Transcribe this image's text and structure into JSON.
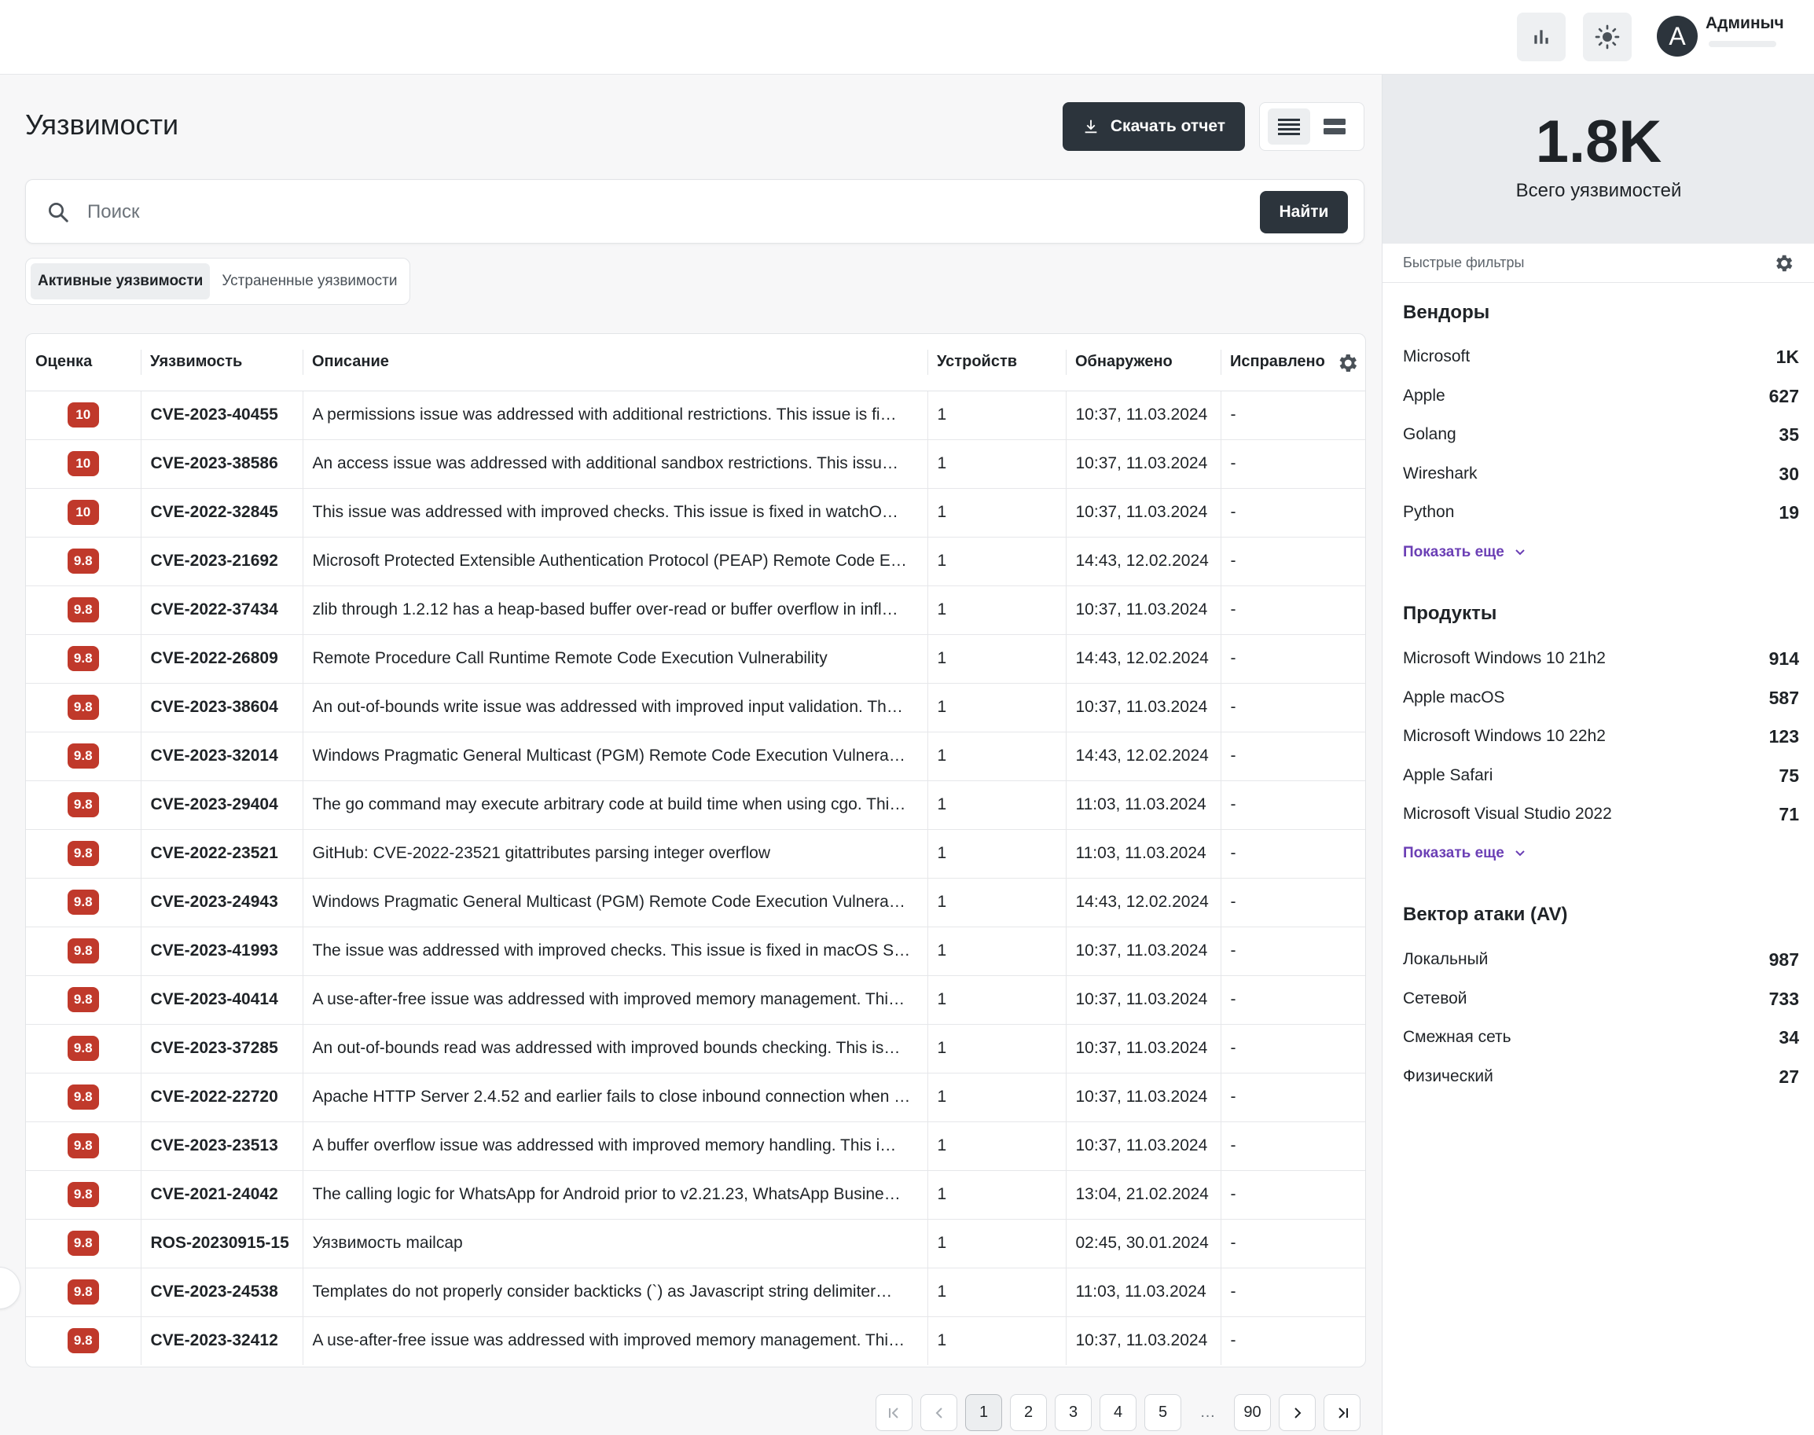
{
  "topbar": {
    "user_name": "Админыч",
    "user_initial": "A"
  },
  "page": {
    "title": "Уязвимости",
    "download_label": "Скачать отчет"
  },
  "search": {
    "placeholder": "Поиск",
    "button_label": "Найти"
  },
  "tabs": [
    {
      "label": "Активные уязвимости",
      "active": true
    },
    {
      "label": "Устраненные уязвимости",
      "active": false
    }
  ],
  "table": {
    "columns": [
      "Оценка",
      "Уязвимость",
      "Описание",
      "Устройств",
      "Обнаружено",
      "Исправлено"
    ],
    "rows": [
      {
        "score": "10",
        "id": "CVE-2023-40455",
        "desc": "A permissions issue was addressed with additional restrictions. This issue is fi…",
        "devices": "1",
        "found": "10:37, 11.03.2024",
        "fixed": "-"
      },
      {
        "score": "10",
        "id": "CVE-2023-38586",
        "desc": "An access issue was addressed with additional sandbox restrictions. This issu…",
        "devices": "1",
        "found": "10:37, 11.03.2024",
        "fixed": "-"
      },
      {
        "score": "10",
        "id": "CVE-2022-32845",
        "desc": "This issue was addressed with improved checks. This issue is fixed in watchO…",
        "devices": "1",
        "found": "10:37, 11.03.2024",
        "fixed": "-"
      },
      {
        "score": "9.8",
        "id": "CVE-2023-21692",
        "desc": "Microsoft Protected Extensible Authentication Protocol (PEAP) Remote Code E…",
        "devices": "1",
        "found": "14:43, 12.02.2024",
        "fixed": "-"
      },
      {
        "score": "9.8",
        "id": "CVE-2022-37434",
        "desc": "zlib through 1.2.12 has a heap-based buffer over-read or buffer overflow in infl…",
        "devices": "1",
        "found": "10:37, 11.03.2024",
        "fixed": "-"
      },
      {
        "score": "9.8",
        "id": "CVE-2022-26809",
        "desc": "Remote Procedure Call Runtime Remote Code Execution Vulnerability",
        "devices": "1",
        "found": "14:43, 12.02.2024",
        "fixed": "-"
      },
      {
        "score": "9.8",
        "id": "CVE-2023-38604",
        "desc": "An out-of-bounds write issue was addressed with improved input validation. Th…",
        "devices": "1",
        "found": "10:37, 11.03.2024",
        "fixed": "-"
      },
      {
        "score": "9.8",
        "id": "CVE-2023-32014",
        "desc": "Windows Pragmatic General Multicast (PGM) Remote Code Execution Vulnera…",
        "devices": "1",
        "found": "14:43, 12.02.2024",
        "fixed": "-"
      },
      {
        "score": "9.8",
        "id": "CVE-2023-29404",
        "desc": "The go command may execute arbitrary code at build time when using cgo. Thi…",
        "devices": "1",
        "found": "11:03, 11.03.2024",
        "fixed": "-"
      },
      {
        "score": "9.8",
        "id": "CVE-2022-23521",
        "desc": "GitHub: CVE-2022-23521 gitattributes parsing integer overflow",
        "devices": "1",
        "found": "11:03, 11.03.2024",
        "fixed": "-"
      },
      {
        "score": "9.8",
        "id": "CVE-2023-24943",
        "desc": "Windows Pragmatic General Multicast (PGM) Remote Code Execution Vulnera…",
        "devices": "1",
        "found": "14:43, 12.02.2024",
        "fixed": "-"
      },
      {
        "score": "9.8",
        "id": "CVE-2023-41993",
        "desc": "The issue was addressed with improved checks. This issue is fixed in macOS S…",
        "devices": "1",
        "found": "10:37, 11.03.2024",
        "fixed": "-"
      },
      {
        "score": "9.8",
        "id": "CVE-2023-40414",
        "desc": "A use-after-free issue was addressed with improved memory management. Thi…",
        "devices": "1",
        "found": "10:37, 11.03.2024",
        "fixed": "-"
      },
      {
        "score": "9.8",
        "id": "CVE-2023-37285",
        "desc": "An out-of-bounds read was addressed with improved bounds checking. This is…",
        "devices": "1",
        "found": "10:37, 11.03.2024",
        "fixed": "-"
      },
      {
        "score": "9.8",
        "id": "CVE-2022-22720",
        "desc": "Apache HTTP Server 2.4.52 and earlier fails to close inbound connection when …",
        "devices": "1",
        "found": "10:37, 11.03.2024",
        "fixed": "-"
      },
      {
        "score": "9.8",
        "id": "CVE-2023-23513",
        "desc": "A buffer overflow issue was addressed with improved memory handling. This i…",
        "devices": "1",
        "found": "10:37, 11.03.2024",
        "fixed": "-"
      },
      {
        "score": "9.8",
        "id": "CVE-2021-24042",
        "desc": "The calling logic for WhatsApp for Android prior to v2.21.23, WhatsApp Busine…",
        "devices": "1",
        "found": "13:04, 21.02.2024",
        "fixed": "-"
      },
      {
        "score": "9.8",
        "id": "ROS-20230915-15",
        "desc": "Уязвимость mailcap",
        "devices": "1",
        "found": "02:45, 30.01.2024",
        "fixed": "-"
      },
      {
        "score": "9.8",
        "id": "CVE-2023-24538",
        "desc": "Templates do not properly consider backticks (`) as Javascript string delimiter…",
        "devices": "1",
        "found": "11:03, 11.03.2024",
        "fixed": "-"
      },
      {
        "score": "9.8",
        "id": "CVE-2023-32412",
        "desc": "A use-after-free issue was addressed with improved memory management. Thi…",
        "devices": "1",
        "found": "10:37, 11.03.2024",
        "fixed": "-"
      }
    ]
  },
  "pagination": {
    "pages": [
      "1",
      "2",
      "3",
      "4",
      "5",
      "…",
      "90"
    ],
    "current": "1"
  },
  "summary": {
    "value": "1.8K",
    "label": "Всего уязвимостей"
  },
  "quick_filters": {
    "title": "Быстрые фильтры",
    "show_more": "Показать еще",
    "vendors": {
      "title": "Вендоры",
      "items": [
        {
          "name": "Microsoft",
          "count": "1K"
        },
        {
          "name": "Apple",
          "count": "627"
        },
        {
          "name": "Golang",
          "count": "35"
        },
        {
          "name": "Wireshark",
          "count": "30"
        },
        {
          "name": "Python",
          "count": "19"
        }
      ]
    },
    "products": {
      "title": "Продукты",
      "items": [
        {
          "name": "Microsoft Windows 10 21h2",
          "count": "914"
        },
        {
          "name": "Apple macOS",
          "count": "587"
        },
        {
          "name": "Microsoft Windows 10 22h2",
          "count": "123"
        },
        {
          "name": "Apple Safari",
          "count": "75"
        },
        {
          "name": "Microsoft Visual Studio 2022",
          "count": "71"
        }
      ]
    },
    "attack_vector": {
      "title": "Вектор атаки (AV)",
      "items": [
        {
          "name": "Локальный",
          "count": "987"
        },
        {
          "name": "Сетевой",
          "count": "733"
        },
        {
          "name": "Смежная сеть",
          "count": "34"
        },
        {
          "name": "Физический",
          "count": "27"
        }
      ]
    }
  },
  "colors": {
    "primary_dark": "#2c343c",
    "severity_critical": "#c0392b",
    "link_purple": "#6b3fb5"
  }
}
